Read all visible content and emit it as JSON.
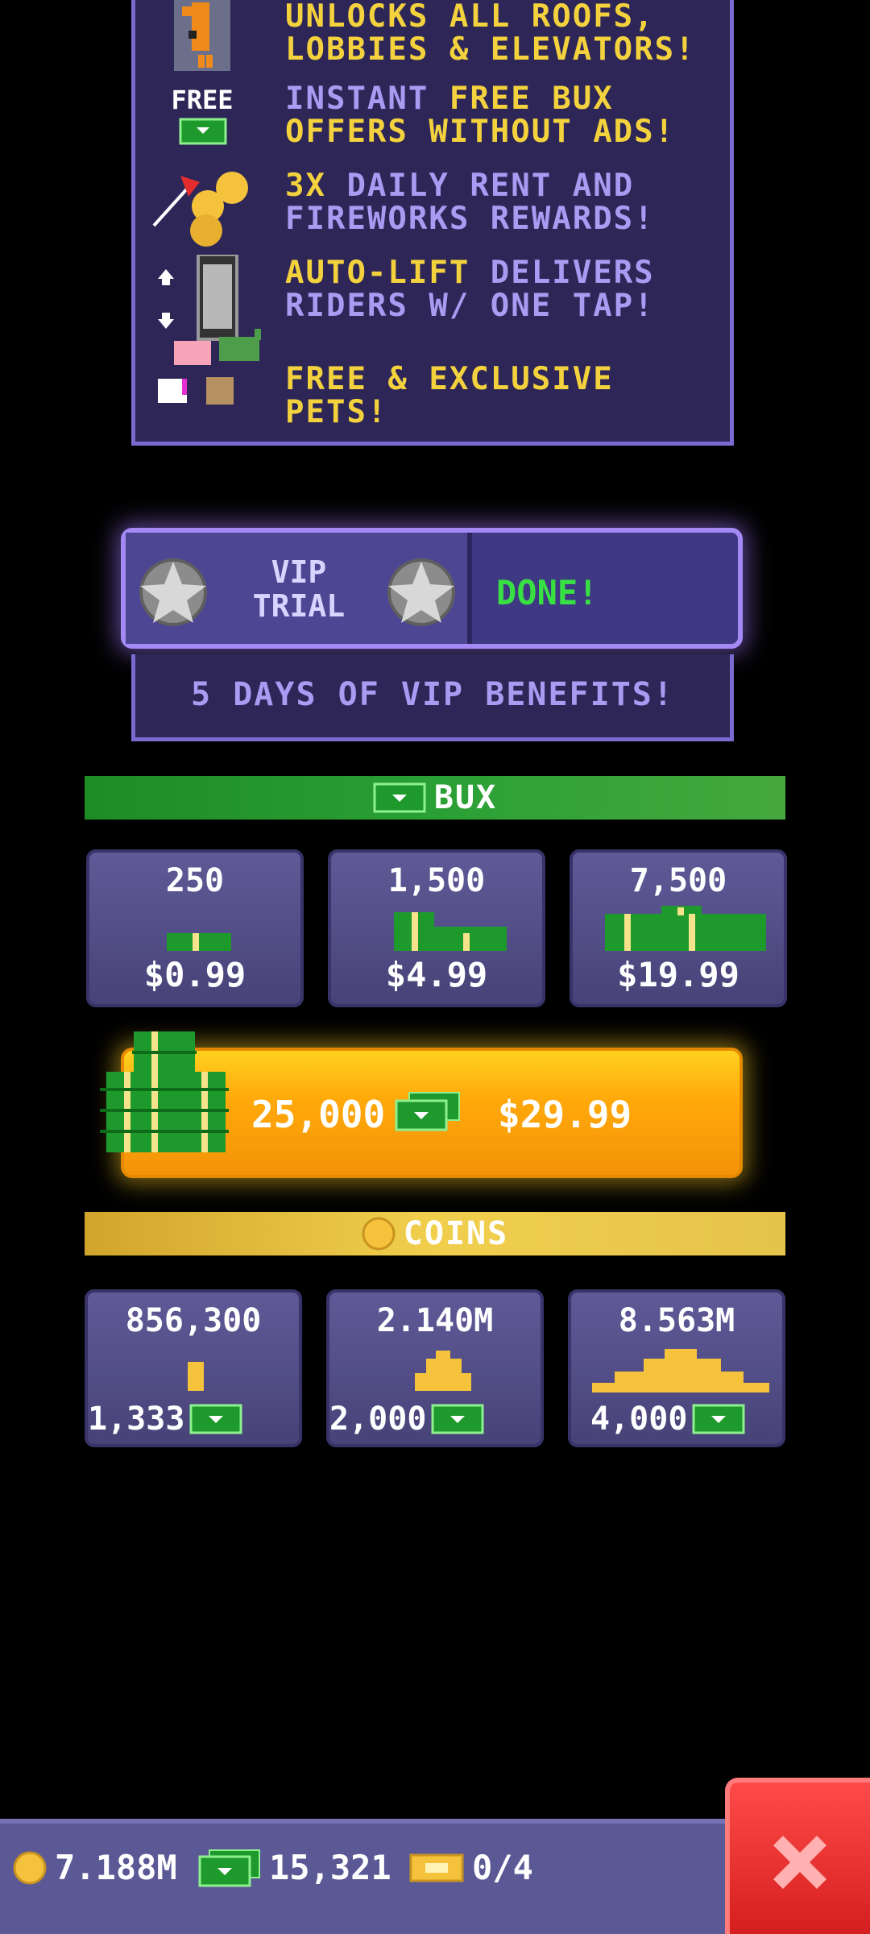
{
  "benefits": [
    {
      "lines": [
        [
          {
            "t": "UNLOCKS ALL ROOFS,",
            "hl": true
          }
        ],
        [
          {
            "t": "LOBBIES & ELEVATORS!",
            "hl": true
          }
        ]
      ],
      "icon": "pixel-pet-icon"
    },
    {
      "lines": [
        [
          {
            "t": "INSTANT ",
            "hl": false
          },
          {
            "t": "FREE BUX",
            "hl": true
          }
        ],
        [
          {
            "t": "OFFERS WITHOUT ADS!",
            "hl": true
          }
        ]
      ],
      "icon": "free-bux-icon",
      "icon_label": "FREE"
    },
    {
      "lines": [
        [
          {
            "t": "3X",
            "hl": true
          },
          {
            "t": " DAILY RENT AND",
            "hl": false
          }
        ],
        [
          {
            "t": "FIREWORKS REWARDS!",
            "hl": false
          }
        ]
      ],
      "icon": "firework-coins-icon"
    },
    {
      "lines": [
        [
          {
            "t": "AUTO-LIFT",
            "hl": true
          },
          {
            "t": " DELIVERS",
            "hl": false
          }
        ],
        [
          {
            "t": "RIDERS W/ ONE TAP!",
            "hl": false
          }
        ]
      ],
      "icon": "elevator-icon"
    },
    {
      "lines": [
        [
          {
            "t": "FREE & EXCLUSIVE PETS!",
            "hl": true
          }
        ]
      ],
      "icon": "pets-icon"
    }
  ],
  "vip_trial": {
    "label_line1": "VIP",
    "label_line2": "TRIAL",
    "status": "DONE!",
    "description": "5 DAYS OF VIP BENEFITS!"
  },
  "bux_section": {
    "title": "BUX",
    "packs": [
      {
        "amount": "250",
        "price": "$0.99"
      },
      {
        "amount": "1,500",
        "price": "$4.99"
      },
      {
        "amount": "7,500",
        "price": "$19.99"
      }
    ],
    "big_offer": {
      "amount": "25,000",
      "price": "$29.99"
    }
  },
  "coins_section": {
    "title": "COINS",
    "packs": [
      {
        "amount": "856,300",
        "cost": "1,333"
      },
      {
        "amount": "2.140M",
        "cost": "2,000"
      },
      {
        "amount": "8.563M",
        "cost": "4,000"
      }
    ]
  },
  "status_bar": {
    "coins": "7.188M",
    "bux": "15,321",
    "tickets": "0/4"
  },
  "colors": {
    "highlight": "#f3d23d",
    "text_muted": "#a99af2",
    "done_green": "#39e044",
    "panel": "#2e2657"
  }
}
